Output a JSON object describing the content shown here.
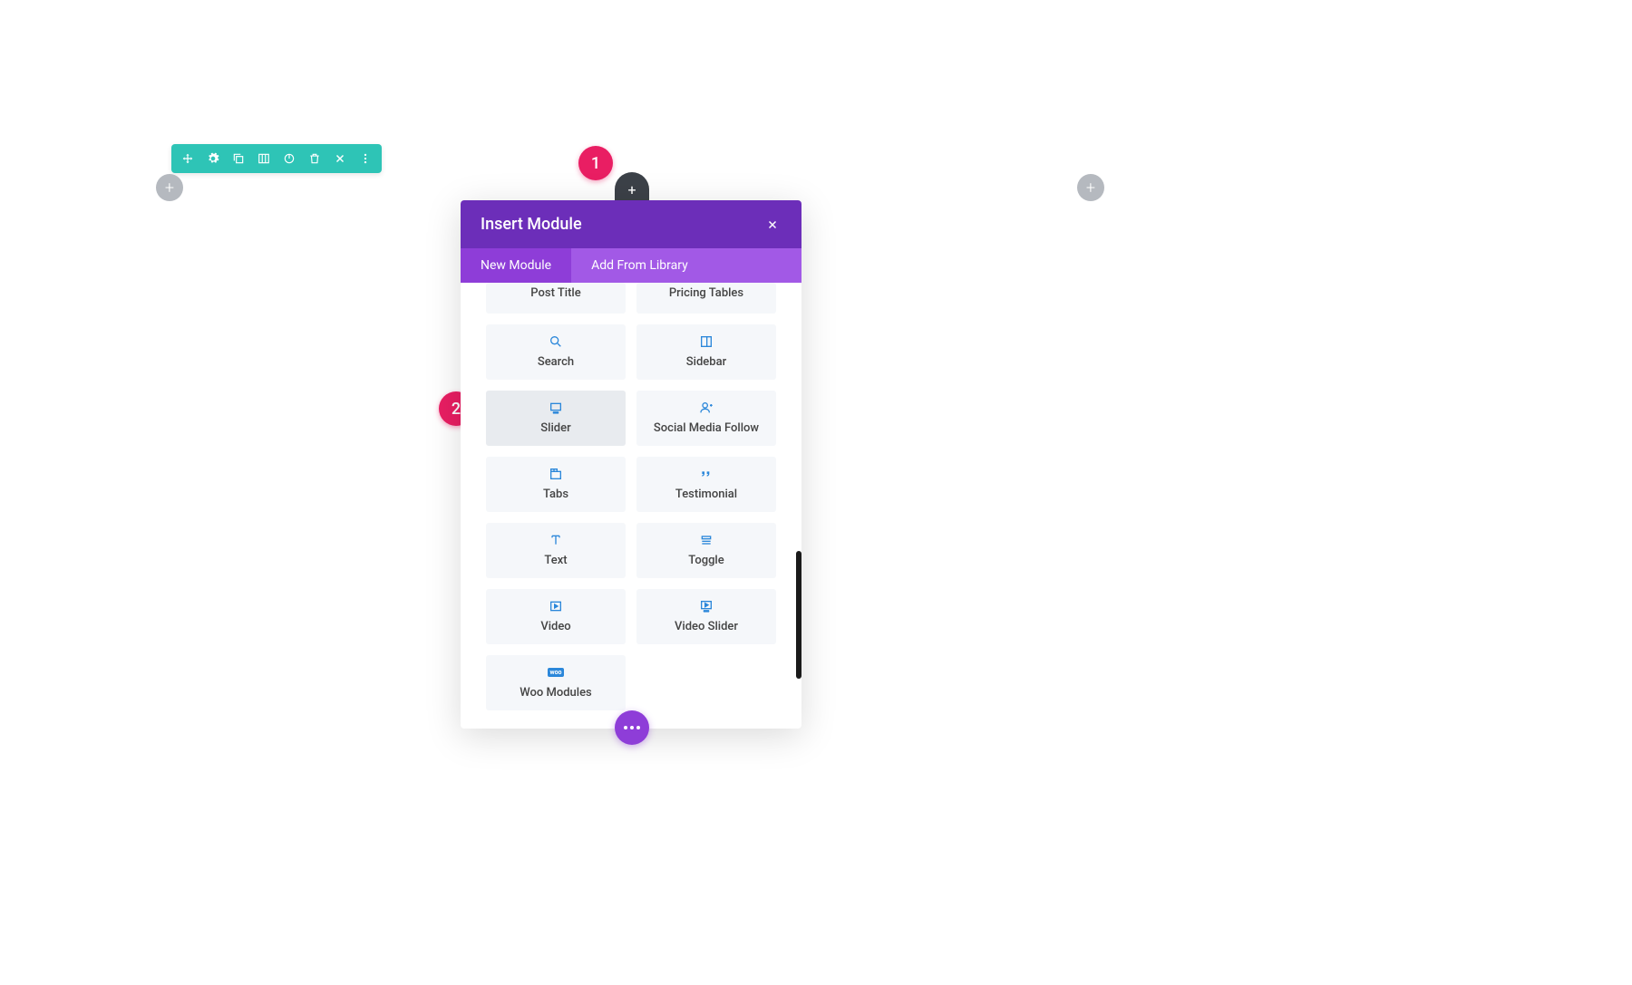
{
  "toolbar": {
    "icons": [
      "move",
      "settings",
      "duplicate",
      "columns",
      "save",
      "delete",
      "close",
      "more"
    ]
  },
  "modal": {
    "title": "Insert Module",
    "tabs": {
      "new": "New Module",
      "library": "Add From Library"
    },
    "activeTab": "new"
  },
  "modules": [
    {
      "label": "Post Title",
      "icon": "post-title"
    },
    {
      "label": "Pricing Tables",
      "icon": "pricing"
    },
    {
      "label": "Search",
      "icon": "search"
    },
    {
      "label": "Sidebar",
      "icon": "sidebar"
    },
    {
      "label": "Slider",
      "icon": "slider",
      "hover": true
    },
    {
      "label": "Social Media Follow",
      "icon": "social"
    },
    {
      "label": "Tabs",
      "icon": "tabs"
    },
    {
      "label": "Testimonial",
      "icon": "testimonial"
    },
    {
      "label": "Text",
      "icon": "text"
    },
    {
      "label": "Toggle",
      "icon": "toggle"
    },
    {
      "label": "Video",
      "icon": "video"
    },
    {
      "label": "Video Slider",
      "icon": "video-slider"
    },
    {
      "label": "Woo Modules",
      "icon": "woo"
    }
  ],
  "annotations": {
    "one": "1",
    "two": "2"
  }
}
